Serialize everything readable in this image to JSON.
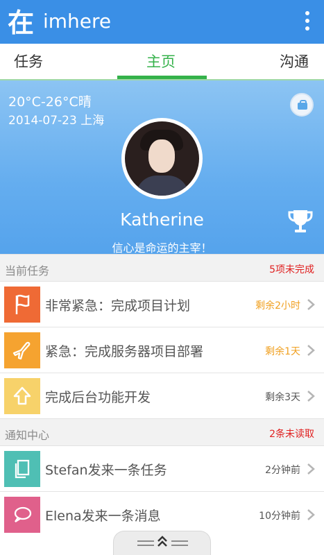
{
  "app": {
    "title": "imhere",
    "logo_text": "在"
  },
  "tabs": [
    {
      "label": "任务"
    },
    {
      "label": "主页"
    },
    {
      "label": "沟通"
    }
  ],
  "hero": {
    "weather": "20°C-26°C晴",
    "date_location": "2014-07-23 上海",
    "user_name": "Katherine",
    "motto": "信心是命运的主宰！"
  },
  "current_tasks": {
    "title": "当前任务",
    "count_text": "5项未完成",
    "items": [
      {
        "label": "非常紧急：完成项目计划",
        "meta": "剩余2小时",
        "icon": "flag-icon",
        "color": "#ef6a35"
      },
      {
        "label": "紧急：完成服务器项目部署",
        "meta": "剩余1天",
        "icon": "airplane-icon",
        "color": "#f5a330"
      },
      {
        "label": "完成后台功能开发",
        "meta": "剩余3天",
        "icon": "up-arrow-icon",
        "color": "#f7d26a"
      }
    ]
  },
  "notifications": {
    "title": "通知中心",
    "count_text": "2条未读取",
    "items": [
      {
        "label": "Stefan发来一条任务",
        "meta": "2分钟前",
        "icon": "document-icon",
        "color": "#4fbfb4"
      },
      {
        "label": "Elena发来一条消息",
        "meta": "10分钟前",
        "icon": "chat-bubble-icon",
        "color": "#e0608b"
      }
    ]
  },
  "colors": {
    "primary": "#3a8fe6",
    "tab_active": "#34b24a",
    "alert": "#e02020",
    "due_soon": "#f0a020"
  }
}
